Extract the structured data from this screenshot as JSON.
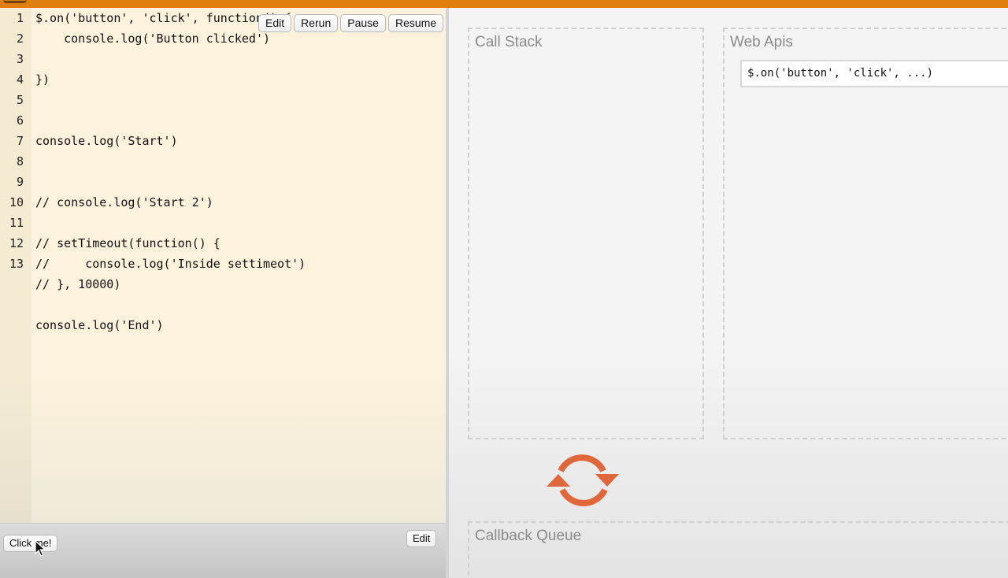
{
  "editor": {
    "line_numbers": [
      "1",
      "2",
      "3",
      "4",
      "5",
      "6",
      "7",
      "8",
      "9",
      "10",
      "11",
      "12",
      "13"
    ],
    "code_lines": [
      "$.on('button', 'click', function() {",
      "    console.log('Button clicked')",
      "",
      "})",
      "",
      "",
      "console.log('Start')",
      "",
      "",
      "// console.log('Start 2')",
      "",
      "// setTimeout(function() {",
      "//     console.log('Inside settimeot')",
      "// }, 10000)",
      "",
      "console.log('End')"
    ]
  },
  "toolbar": {
    "edit_label": "Edit",
    "rerun_label": "Rerun",
    "pause_label": "Pause",
    "resume_label": "Resume"
  },
  "html_panel": {
    "click_button_label": "Click me!",
    "edit_label": "Edit"
  },
  "call_stack": {
    "title": "Call Stack"
  },
  "web_apis": {
    "title": "Web Apis",
    "items": [
      "$.on('button', 'click', ...)"
    ]
  },
  "callback_queue": {
    "title": "Callback Queue"
  },
  "colors": {
    "brand_orange": "#e07f0e",
    "event_loop_icon": "#e0673a",
    "editor_bg": "#fdf2dc"
  },
  "icons": {
    "event_loop": "event-loop-icon",
    "cursor": "mouse-cursor-icon"
  }
}
